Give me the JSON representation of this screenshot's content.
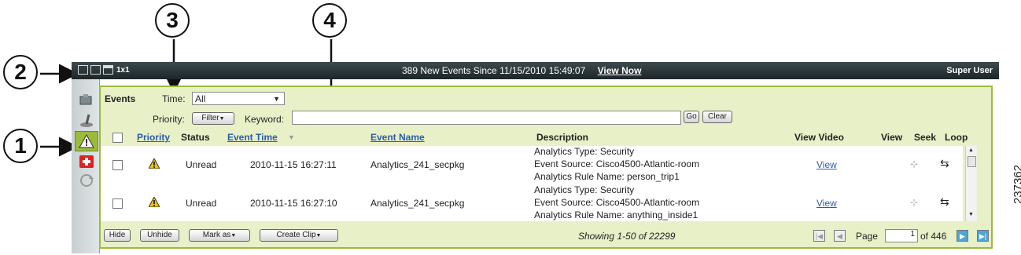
{
  "callouts": [
    "1",
    "2",
    "3",
    "4"
  ],
  "side_label": "237362",
  "topbar": {
    "layout_label": "1x1",
    "notice": "389 New Events Since 11/15/2010 15:49:07",
    "view_now": "View Now",
    "user": "Super User"
  },
  "filters": {
    "title": "Events",
    "time_label": "Time:",
    "time_value": "All",
    "priority_label": "Priority:",
    "filter_button": "Filter",
    "keyword_label": "Keyword:",
    "keyword_value": "",
    "go": "Go",
    "clear": "Clear"
  },
  "columns": {
    "priority": "Priority",
    "status": "Status",
    "event_time": "Event Time",
    "event_name": "Event Name",
    "description": "Description",
    "view_video": "View Video",
    "view": "View",
    "seek": "Seek",
    "loop": "Loop"
  },
  "rows": [
    {
      "status": "Unread",
      "time": "2010-11-15 16:27:11",
      "name": "Analytics_241_secpkg",
      "desc1": "Analytics Type: Security",
      "desc2": "Event Source: Cisco4500-Atlantic-room",
      "desc3": "Analytics Rule Name: person_trip1",
      "video": "View"
    },
    {
      "status": "Unread",
      "time": "2010-11-15 16:27:10",
      "name": "Analytics_241_secpkg",
      "desc1": "Analytics Type: Security",
      "desc2": "Event Source: Cisco4500-Atlantic-room",
      "desc3": "Analytics Rule Name: anything_inside1",
      "video": "View"
    }
  ],
  "footer": {
    "hide": "Hide",
    "unhide": "Unhide",
    "mark_as": "Mark as",
    "create_clip": "Create Clip",
    "showing": "Showing 1-50 of 22299",
    "page_label": "Page",
    "page_value": "1",
    "page_total": "of 446"
  },
  "colors": {
    "accent": "#9bbb3a",
    "link": "#2a5cab",
    "bar": "#1d2528"
  }
}
